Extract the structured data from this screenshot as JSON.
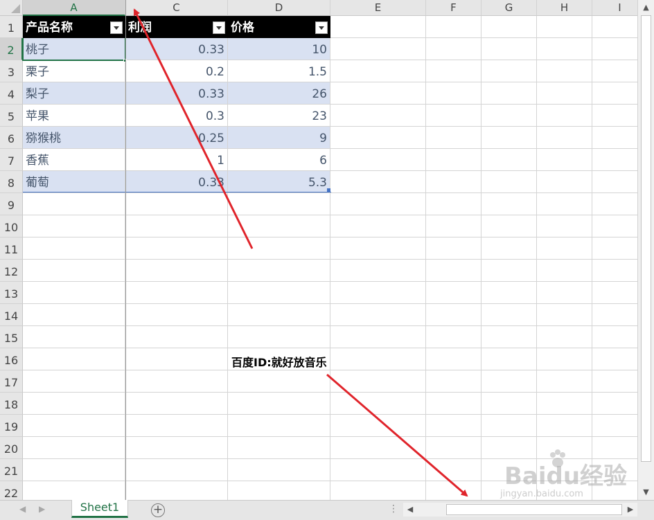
{
  "columns": [
    {
      "id": "A",
      "label": "A",
      "selected": true
    },
    {
      "id": "C",
      "label": "C",
      "selected": false
    },
    {
      "id": "D",
      "label": "D",
      "selected": false
    },
    {
      "id": "E",
      "label": "E",
      "selected": false
    },
    {
      "id": "F",
      "label": "F",
      "selected": false
    },
    {
      "id": "G",
      "label": "G",
      "selected": false
    },
    {
      "id": "H",
      "label": "H",
      "selected": false
    },
    {
      "id": "I",
      "label": "I",
      "selected": false
    }
  ],
  "rows": [
    "1",
    "2",
    "3",
    "4",
    "5",
    "6",
    "7",
    "8",
    "9",
    "10",
    "11",
    "12",
    "13",
    "14",
    "15",
    "16",
    "17",
    "18",
    "19",
    "20",
    "21",
    "22"
  ],
  "selected_row": "2",
  "table": {
    "headers": [
      "产品名称",
      "利润",
      "价格"
    ],
    "rows": [
      [
        "桃子",
        "0.33",
        "10"
      ],
      [
        "栗子",
        "0.2",
        "1.5"
      ],
      [
        "梨子",
        "0.33",
        "26"
      ],
      [
        "苹果",
        "0.3",
        "23"
      ],
      [
        "猕猴桃",
        "0.25",
        "9"
      ],
      [
        "香蕉",
        "1",
        "6"
      ],
      [
        "葡萄",
        "0.33",
        "5.3"
      ]
    ]
  },
  "annotation": "百度ID:就好放音乐",
  "watermark": {
    "logo": "Baidu经验",
    "sub": "jingyan.baidu.com"
  },
  "sheet_tab": "Sheet1",
  "add_sheet_symbol": "+",
  "colors": {
    "accent": "#217346",
    "band": "#d9e1f2",
    "header_bg": "#000000",
    "cell_text": "#44546a",
    "arrow": "#e0242b"
  }
}
